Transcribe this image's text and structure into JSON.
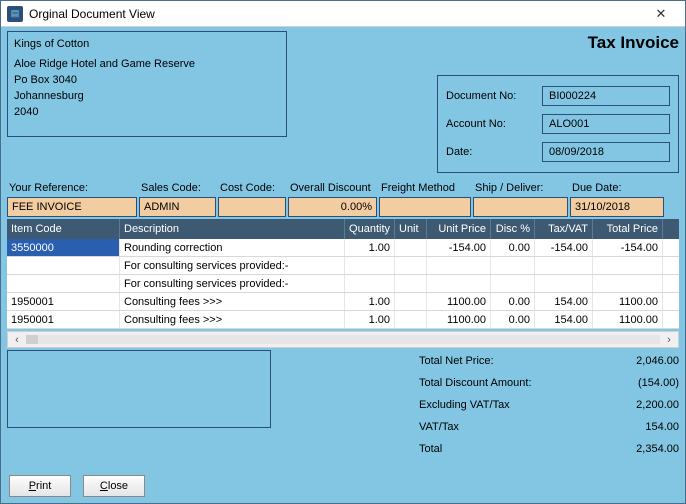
{
  "window": {
    "title": "Orginal Document View"
  },
  "customer": {
    "company": "Kings of Cotton",
    "line1": "Aloe Ridge Hotel and Game Reserve",
    "line2": "Po Box 3040",
    "line3": "Johannesburg",
    "line4": "2040"
  },
  "doc_title": "Tax Invoice",
  "meta": {
    "labels": {
      "docno": "Document No:",
      "acct": "Account No:",
      "date": "Date:"
    },
    "docno": "BI000224",
    "acct": "ALO001",
    "date": "08/09/2018"
  },
  "filters": {
    "labels": {
      "ref": "Your Reference:",
      "sales": "Sales Code:",
      "cost": "Cost Code:",
      "disc": "Overall Discount",
      "freight": "Freight Method",
      "ship": "Ship / Deliver:",
      "due": "Due Date:"
    },
    "ref": "FEE INVOICE",
    "sales": "ADMIN",
    "cost": "",
    "disc": "0.00%",
    "freight": "",
    "ship": "",
    "due": "31/10/2018"
  },
  "grid": {
    "headers": {
      "code": "Item Code",
      "desc": "Description",
      "qty": "Quantity",
      "unit": "Unit",
      "price": "Unit Price",
      "discp": "Disc %",
      "tax": "Tax/VAT",
      "total": "Total Price"
    },
    "rows": [
      {
        "code": "3550000",
        "desc": "Rounding correction",
        "qty": "1.00",
        "unit": "",
        "price": "-154.00",
        "discp": "0.00",
        "tax": "-154.00",
        "total": "-154.00",
        "selected": true
      },
      {
        "code": "",
        "desc": "For consulting services provided:-",
        "qty": "",
        "unit": "",
        "price": "",
        "discp": "",
        "tax": "",
        "total": ""
      },
      {
        "code": "",
        "desc": "For consulting services provided:-",
        "qty": "",
        "unit": "",
        "price": "",
        "discp": "",
        "tax": "",
        "total": ""
      },
      {
        "code": "1950001",
        "desc": "Consulting fees >>>",
        "qty": "1.00",
        "unit": "",
        "price": "1100.00",
        "discp": "0.00",
        "tax": "154.00",
        "total": "1100.00"
      },
      {
        "code": "1950001",
        "desc": "Consulting fees >>>",
        "qty": "1.00",
        "unit": "",
        "price": "1100.00",
        "discp": "0.00",
        "tax": "154.00",
        "total": "1100.00"
      }
    ]
  },
  "totals": {
    "labels": {
      "net": "Total Net Price:",
      "disc": "Total Discount Amount:",
      "excl": "Excluding VAT/Tax",
      "vat": "VAT/Tax",
      "total": "Total"
    },
    "net": "2,046.00",
    "disc": "(154.00)",
    "excl": "2,200.00",
    "vat": "154.00",
    "total": "2,354.00"
  },
  "buttons": {
    "print": "Print",
    "close": "Close",
    "print_ul": "P",
    "print_rest": "rint",
    "close_ul": "C",
    "close_rest": "lose"
  }
}
